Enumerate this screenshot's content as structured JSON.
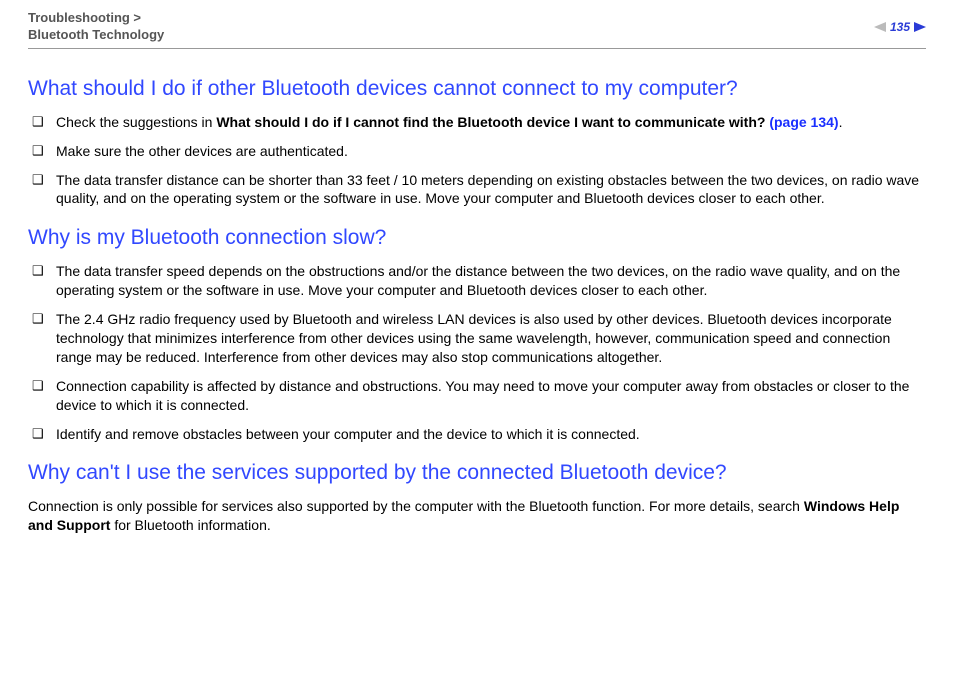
{
  "header": {
    "breadcrumb_line1": "Troubleshooting >",
    "breadcrumb_line2": "Bluetooth Technology",
    "page_number": "135"
  },
  "sections": {
    "s1": {
      "heading": "What should I do if other Bluetooth devices cannot connect to my computer?",
      "b1_pre": "Check the suggestions in ",
      "b1_bold": "What should I do if I cannot find the Bluetooth device I want to communicate with? ",
      "b1_link": "(page 134)",
      "b1_post": ".",
      "b2": "Make sure the other devices are authenticated.",
      "b3": "The data transfer distance can be shorter than 33 feet / 10 meters depending on existing obstacles between the two devices, on radio wave quality, and on the operating system or the software in use. Move your computer and Bluetooth devices closer to each other."
    },
    "s2": {
      "heading": "Why is my Bluetooth connection slow?",
      "b1": "The data transfer speed depends on the obstructions and/or the distance between the two devices, on the radio wave quality, and on the operating system or the software in use. Move your computer and Bluetooth devices closer to each other.",
      "b2": "The 2.4 GHz radio frequency used by Bluetooth and wireless LAN devices is also used by other devices. Bluetooth devices incorporate technology that minimizes interference from other devices using the same wavelength, however, communication speed and connection range may be reduced. Interference from other devices may also stop communications altogether.",
      "b3": "Connection capability is affected by distance and obstructions. You may need to move your computer away from obstacles or closer to the device to which it is connected.",
      "b4": "Identify and remove obstacles between your computer and the device to which it is connected."
    },
    "s3": {
      "heading": "Why can't I use the services supported by the connected Bluetooth device?",
      "p_pre": "Connection is only possible for services also supported by the computer with the Bluetooth function. For more details, search ",
      "p_bold": "Windows Help and Support",
      "p_post": " for Bluetooth information."
    }
  }
}
